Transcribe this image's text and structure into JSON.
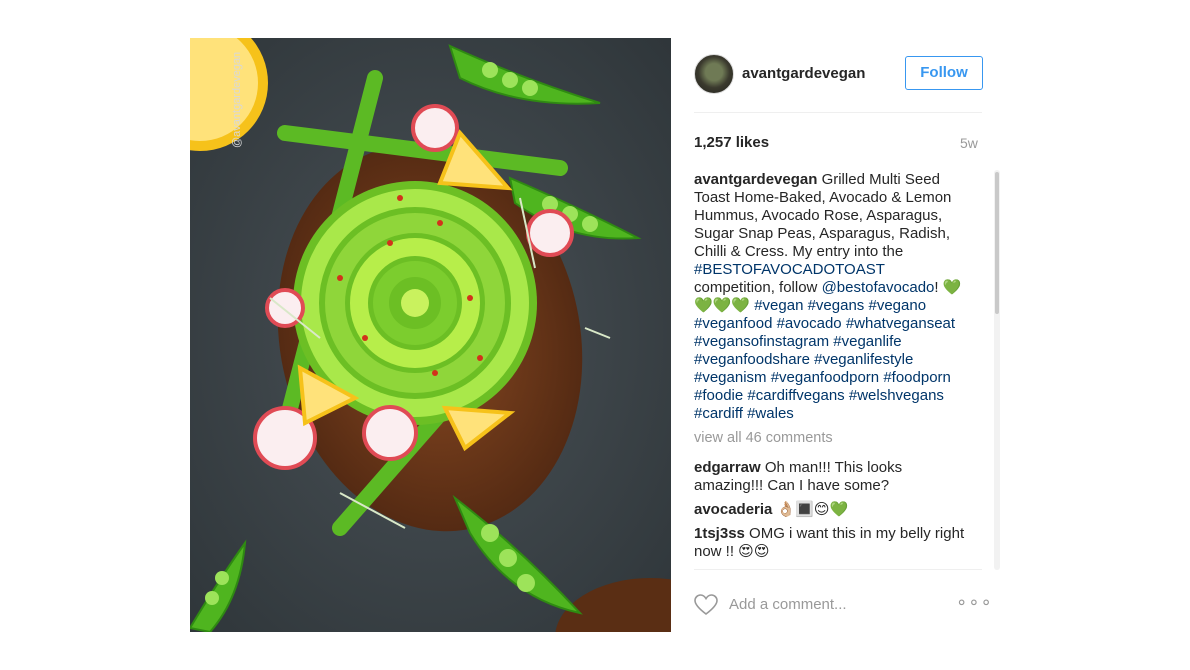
{
  "photo": {
    "watermark": "@avantgardevegan",
    "colors": {
      "slate": "#3b4246",
      "avocado": "#7ccd2e",
      "avocado_light": "#b7ee4a",
      "lemon": "#f6c21a",
      "radish": "#e04b55",
      "toast": "#6b3a1c"
    }
  },
  "post": {
    "username": "avantgardevegan",
    "follow_label": "Follow",
    "likes": "1,257 likes",
    "age": "5w",
    "caption": {
      "author": "avantgardevegan",
      "text_1": "Grilled Multi Seed Toast Home-Baked, Avocado & Lemon Hummus, Avocado Rose, Asparagus, Sugar Snap Peas, Asparagus, Radish, Chilli & Cress. My entry into the",
      "hashtag_contest": "#BESTOFAVOCADOTOAST",
      "text_2": "competition, follow",
      "mention": "@bestofavocado",
      "text_3": "! 💚💚💚💚",
      "hashtags": [
        "#vegan",
        "#vegans",
        "#vegano",
        "#veganfood",
        "#avocado",
        "#whatveganseat",
        "#vegansofinstagram",
        "#veganlife",
        "#veganfoodshare",
        "#veganlifestyle",
        "#veganism",
        "#veganfoodporn",
        "#foodporn",
        "#foodie",
        "#cardiffvegans",
        "#welshvegans",
        "#cardiff",
        "#wales"
      ]
    },
    "view_all": "view all 46 comments",
    "comments": [
      {
        "author": "edgarraw",
        "text": "Oh man!!! This looks amazing!!! Can I have some?"
      },
      {
        "author": "avocaderia",
        "text": "👌🏼🔳😊💚"
      },
      {
        "author": "1tsj3ss",
        "text": "OMG i want this in my belly right now !! 😍😍"
      }
    ],
    "add_comment_placeholder": "Add a comment...",
    "more_label": "∘∘∘",
    "accent_color": "#3897f0",
    "link_color": "#003569"
  }
}
